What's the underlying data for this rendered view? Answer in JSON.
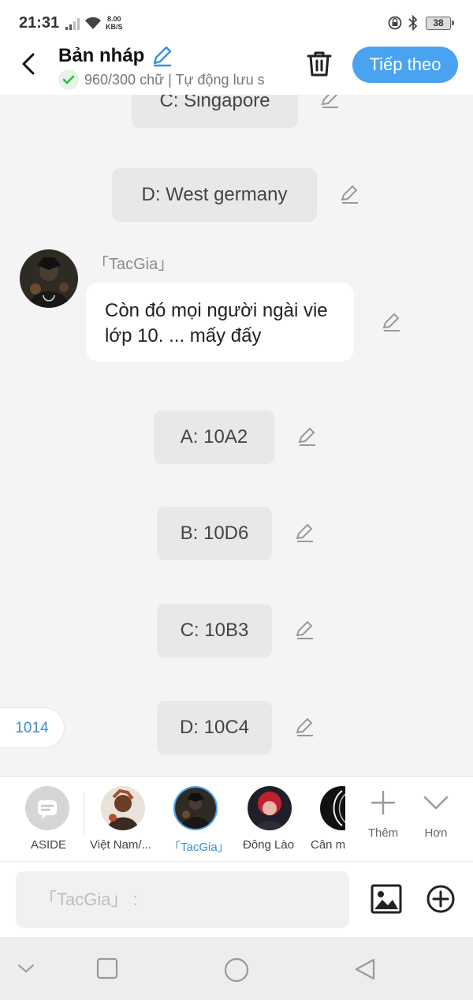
{
  "status": {
    "time": "21:31",
    "speed_value": "8.00",
    "speed_unit": "KB/S",
    "battery": "38"
  },
  "header": {
    "title": "Bản nháp",
    "subtitle": "960/300 chữ | Tự động lưu s",
    "next_label": "Tiếp theo"
  },
  "chat": {
    "options_top": [
      {
        "text": "C: Singapore"
      },
      {
        "text": "D: West germany"
      }
    ],
    "message": {
      "sender": "「TacGia」",
      "text": "Còn đó mọi người ngài vie lớp 10. ... mấy đấy"
    },
    "options": [
      {
        "text": "A: 10A2"
      },
      {
        "text": "B: 10D6"
      },
      {
        "text": "C: 10B3"
      },
      {
        "text": "D: 10C4"
      }
    ],
    "count_badge": "1014"
  },
  "characters": [
    {
      "label": "ASIDE",
      "icon": "aside-chat-icon"
    },
    {
      "label": "Việt Nam/..."
    },
    {
      "label": "「TacGia」",
      "selected": true
    },
    {
      "label": "Đông Lào"
    },
    {
      "label": "Cân m"
    }
  ],
  "actions": {
    "add_label": "Thêm",
    "more_label": "Hơn"
  },
  "input": {
    "placeholder": "「TacGia」 :"
  },
  "colors": {
    "accent": "#4aa3f0",
    "selected_label": "#3b8fd6",
    "bubble_option": "#e8e8e8",
    "background": "#f4f4f4"
  }
}
